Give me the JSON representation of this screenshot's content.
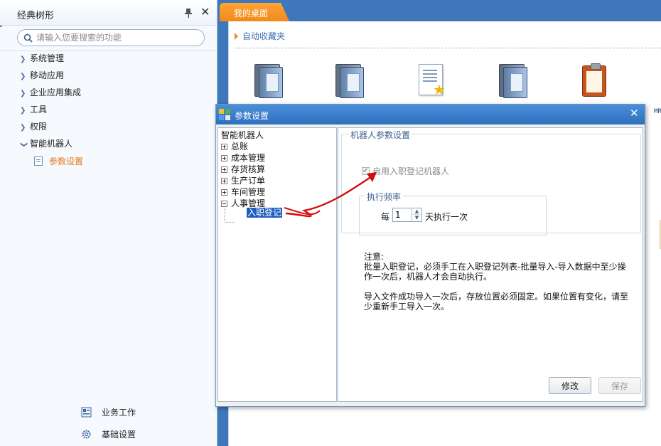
{
  "left_panel": {
    "title": "经典树形",
    "search_placeholder": "请输入您要搜索的功能",
    "nav": [
      {
        "label": "系统管理"
      },
      {
        "label": "移动应用"
      },
      {
        "label": "企业应用集成"
      },
      {
        "label": "工具"
      },
      {
        "label": "权限"
      },
      {
        "label": "智能机器人"
      }
    ],
    "sub_item": "参数设置",
    "bottom": [
      {
        "label": "业务工作",
        "icon": "business-work-icon"
      },
      {
        "label": "基础设置",
        "icon": "gear-icon"
      }
    ]
  },
  "main": {
    "tab_label": "我的桌面",
    "favorites_title": "自动收藏夹",
    "side_fragment": "MR"
  },
  "dialog": {
    "title": "参数设置",
    "tree": {
      "root": "智能机器人",
      "nodes": [
        "总账",
        "成本管理",
        "存货核算",
        "生产订单",
        "车间管理",
        "人事管理"
      ],
      "selected": "入职登记"
    },
    "group_title": "机器人参数设置",
    "robot_checkbox": "启用入职登记机器人",
    "robot_checked": true,
    "frequency_title": "执行频率",
    "freq_prefix": "每",
    "freq_value": "1",
    "freq_suffix": "天执行一次",
    "note_title": "注意:",
    "note_p1": "批量入职登记，必须手工在入职登记列表-批量导入-导入数据中至少操作一次后，机器人才会自动执行。",
    "note_p2": "导入文件成功导入一次后，存放位置必须固定。如果位置有变化，请至少重新手工导入一次。",
    "btn_edit": "修改",
    "btn_save": "保存"
  },
  "colors": {
    "accent_orange": "#f28a1c",
    "title_blue": "#2f6fbe",
    "annotation_red": "#d40c0c",
    "selected_blue": "#1f5bc0"
  }
}
